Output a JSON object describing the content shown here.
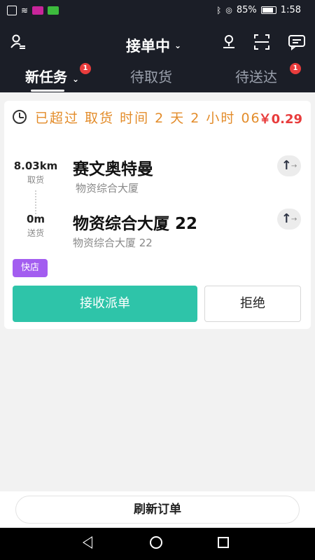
{
  "status_bar": {
    "battery": "85%",
    "time": "1:58"
  },
  "header": {
    "title": "接单中",
    "tabs": [
      {
        "label": "新任务",
        "badge": "1"
      },
      {
        "label": "待取货"
      },
      {
        "label": "待送达",
        "badge": "1"
      }
    ]
  },
  "order": {
    "time_notice": "已超过 取货 时间 2 天 2 小时 06",
    "price": "￥0.29",
    "pickup": {
      "distance": "8.03km",
      "distance_label": "取货",
      "name": "赛文奥特曼",
      "address": "物资综合大厦"
    },
    "delivery": {
      "distance": "0m",
      "distance_label": "送货",
      "name": "物资综合大厦 22",
      "address": "物资综合大厦 22"
    },
    "tag": "快店",
    "accept_label": "接收派单",
    "reject_label": "拒绝"
  },
  "footer": {
    "refresh_label": "刷新订单"
  },
  "colors": {
    "header_bg": "#1b1e27",
    "accent_green": "#2ec4a9",
    "warning_orange": "#e38c2a",
    "price_red": "#e83c3c",
    "tag_purple": "#a35df0"
  }
}
